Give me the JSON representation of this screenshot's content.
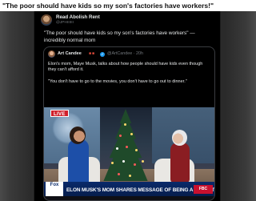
{
  "headline": "\"The poor should have kids so my son's factories have workers!\"",
  "tweet": {
    "author": "Read Abolish Rent",
    "handle": "@JPHIIIIII",
    "text_lines": [
      "\"The poor should have kids so my son's factories have workers\" —",
      "incredibly normal mom"
    ]
  },
  "quoted_tweet": {
    "author": "Art Candee",
    "handle_time": "@ArtCandee · 20h",
    "text_lines": [
      "Elon's mom, Maye Musk, talks about how people should have kids even though",
      "they can't afford it.",
      "",
      "\"You don't have to go to the movies, you don't have to go out to dinner.\""
    ],
    "video": {
      "live_badge": "LIVE",
      "network_logo": "Fox",
      "lower_third": "ELON MUSK'S MOM SHARES MESSAGE OF BEING A PARENT",
      "corner_logo": "FBC"
    }
  },
  "colors": {
    "background_dark": "#2a2a2a",
    "card": "#000000",
    "text_primary": "#e7e9ea",
    "text_secondary": "#71767b",
    "verified": "#1d9bf0",
    "live_red": "#d01f2a"
  }
}
